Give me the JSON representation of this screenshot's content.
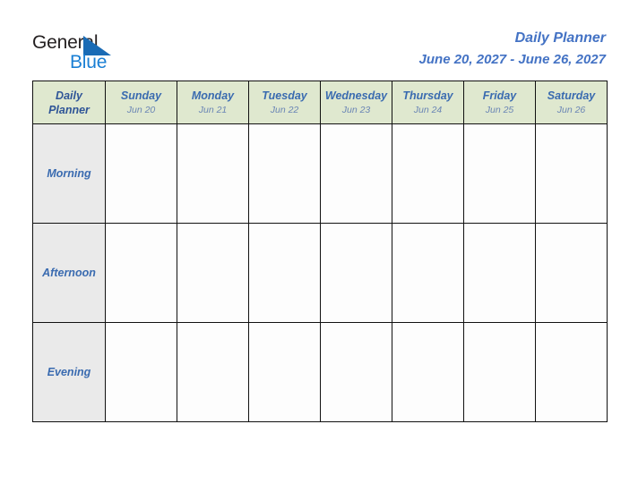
{
  "brand": {
    "name_part1": "General",
    "name_part2": "Blue",
    "logo_icon": "triangle-icon"
  },
  "header": {
    "title": "Daily Planner",
    "date_range": "June 20, 2027 - June 26, 2027"
  },
  "table": {
    "corner_label_line1": "Daily",
    "corner_label_line2": "Planner",
    "columns": [
      {
        "day": "Sunday",
        "date": "Jun 20"
      },
      {
        "day": "Monday",
        "date": "Jun 21"
      },
      {
        "day": "Tuesday",
        "date": "Jun 22"
      },
      {
        "day": "Wednesday",
        "date": "Jun 23"
      },
      {
        "day": "Thursday",
        "date": "Jun 24"
      },
      {
        "day": "Friday",
        "date": "Jun 25"
      },
      {
        "day": "Saturday",
        "date": "Jun 26"
      }
    ],
    "rows": [
      {
        "label": "Morning",
        "cells": [
          "",
          "",
          "",
          "",
          "",
          "",
          ""
        ]
      },
      {
        "label": "Afternoon",
        "cells": [
          "",
          "",
          "",
          "",
          "",
          "",
          ""
        ]
      },
      {
        "label": "Evening",
        "cells": [
          "",
          "",
          "",
          "",
          "",
          "",
          ""
        ]
      }
    ]
  },
  "colors": {
    "header_green": "#dfe8cf",
    "label_gray": "#eaeaea",
    "accent_blue": "#4372c4",
    "day_blue": "#3a6bb0",
    "date_blue": "#6b86b5",
    "logo_blue": "#1a7fd4",
    "border": "#111111"
  }
}
